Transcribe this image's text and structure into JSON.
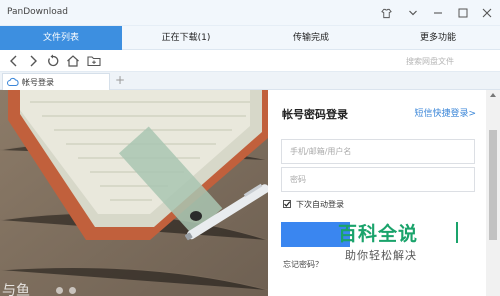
{
  "app": {
    "title": "PanDownload"
  },
  "tabs": [
    {
      "label": "文件列表",
      "active": true
    },
    {
      "label": "正在下载(1)",
      "active": false
    },
    {
      "label": "传输完成",
      "active": false
    },
    {
      "label": "更多功能",
      "active": false
    }
  ],
  "toolbar": {
    "search_placeholder": "搜索网盘文件",
    "icons": [
      "back-icon",
      "forward-icon",
      "refresh-icon",
      "home-icon",
      "new-folder-icon"
    ]
  },
  "page_tab": {
    "label": "帐号登录"
  },
  "login": {
    "title": "帐号密码登录",
    "sms_link": "短信快捷登录>",
    "username_placeholder": "手机/邮箱/用户名",
    "password_placeholder": "密码",
    "auto_login_label": "下次自动登录",
    "auto_login_checked": true,
    "forgot_password": "忘记密码？"
  },
  "banner": {
    "slogan": "与鱼"
  },
  "watermark": {
    "name": "百科全说",
    "subtitle": "助你轻松解决"
  },
  "colors": {
    "accent": "#3d8fe0",
    "button": "#3a86f0",
    "link": "#3a86d8",
    "watermark": "#1aa36b"
  }
}
